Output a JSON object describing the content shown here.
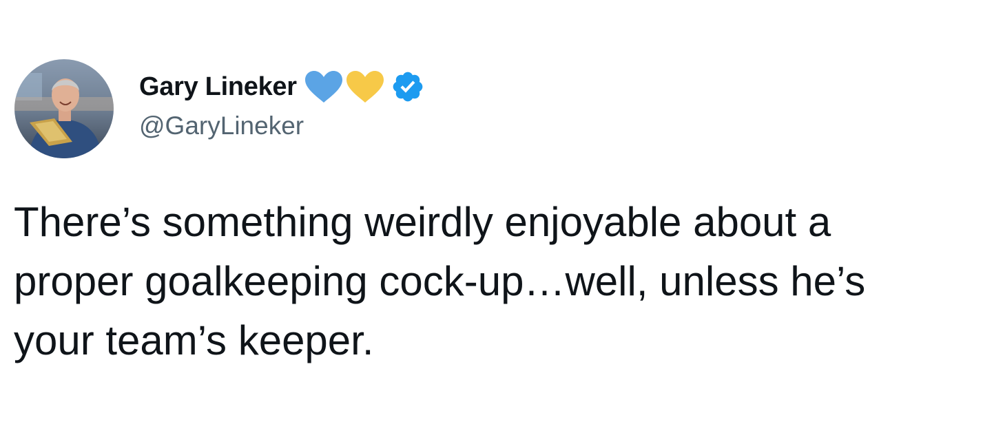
{
  "tweet": {
    "author": {
      "display_name": "Gary Lineker",
      "handle": "@GaryLineker",
      "badges": [
        "blue-heart-icon",
        "yellow-heart-icon",
        "verified-badge-icon"
      ]
    },
    "text_lines": [
      "There’s something weirdly enjoyable about a",
      "proper goalkeeping cock-up…well, unless he’s",
      "your team’s keeper."
    ]
  },
  "colors": {
    "text": "#0f1419",
    "secondary_text": "#536471",
    "blue_heart": "#5ba4e5",
    "yellow_heart": "#f7c948",
    "verified": "#1d9bf0"
  }
}
